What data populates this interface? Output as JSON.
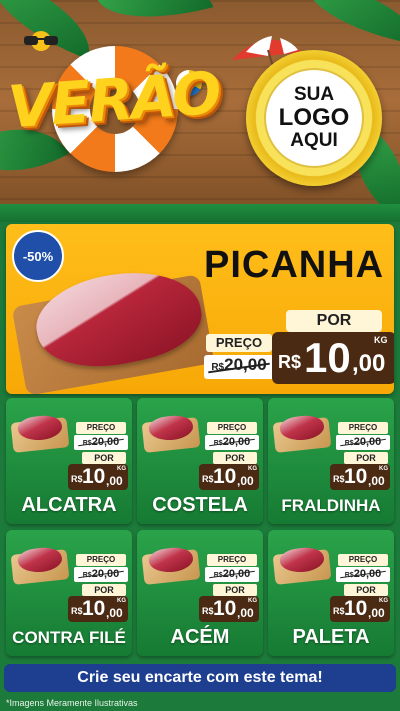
{
  "header": {
    "title": "VERÃO",
    "logo_line1": "SUA",
    "logo_line2": "LOGO",
    "logo_line3": "AQUI"
  },
  "featured": {
    "discount_badge": "-50%",
    "name": "PICANHA",
    "preco_label": "PREÇO",
    "old_currency": "R$",
    "old_price": "20,00",
    "por_label": "POR",
    "new_currency": "R$",
    "new_int": "10",
    "new_dec": ",00",
    "unit": "KG"
  },
  "products": [
    {
      "name": "ALCATRA",
      "preco_label": "PREÇO",
      "old_currency": "R$",
      "old_price": "20,00",
      "por_label": "POR",
      "new_currency": "R$",
      "new_int": "10",
      "new_dec": ",00",
      "unit": "KG"
    },
    {
      "name": "COSTELA",
      "preco_label": "PREÇO",
      "old_currency": "R$",
      "old_price": "20,00",
      "por_label": "POR",
      "new_currency": "R$",
      "new_int": "10",
      "new_dec": ",00",
      "unit": "KG"
    },
    {
      "name": "FRALDINHA",
      "preco_label": "PREÇO",
      "old_currency": "R$",
      "old_price": "20,00",
      "por_label": "POR",
      "new_currency": "R$",
      "new_int": "10",
      "new_dec": ",00",
      "unit": "KG"
    },
    {
      "name": "CONTRA FILÉ",
      "preco_label": "PREÇO",
      "old_currency": "R$",
      "old_price": "20,00",
      "por_label": "POR",
      "new_currency": "R$",
      "new_int": "10",
      "new_dec": ",00",
      "unit": "KG"
    },
    {
      "name": "ACÉM",
      "preco_label": "PREÇO",
      "old_currency": "R$",
      "old_price": "20,00",
      "por_label": "POR",
      "new_currency": "R$",
      "new_int": "10",
      "new_dec": ",00",
      "unit": "KG"
    },
    {
      "name": "PALETA",
      "preco_label": "PREÇO",
      "old_currency": "R$",
      "old_price": "20,00",
      "por_label": "POR",
      "new_currency": "R$",
      "new_int": "10",
      "new_dec": ",00",
      "unit": "KG"
    }
  ],
  "footer": {
    "cta": "Crie seu encarte com este tema!",
    "disclaimer": "*Imagens Meramente Ilustrativas"
  },
  "colors": {
    "background_green": "#1c7a3a",
    "hero_yellow": "#ffbe1a",
    "price_brown": "#4a2a12",
    "cta_blue": "#1e3f8f",
    "badge_blue": "#1f4fa8"
  },
  "icons": [
    "sunglasses-icon",
    "beach-ball-icon",
    "umbrella-icon",
    "life-ring-icon"
  ]
}
